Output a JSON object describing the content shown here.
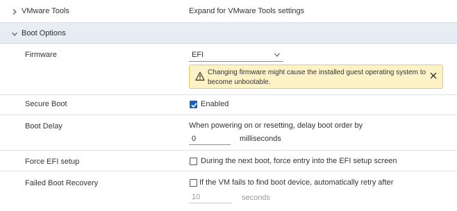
{
  "vmware_tools": {
    "label": "VMware Tools",
    "description": "Expand for VMware Tools settings",
    "icon": "chevron-right-icon"
  },
  "boot_options": {
    "label": "Boot Options",
    "icon": "chevron-down-icon"
  },
  "firmware": {
    "label": "Firmware",
    "selected": "EFI",
    "alert": {
      "message": "Changing firmware might cause the installed guest operating system to become unbootable.",
      "icon": "warning-icon",
      "close_icon": "close-icon"
    }
  },
  "secure_boot": {
    "label": "Secure Boot",
    "checkbox_label": "Enabled",
    "checked": true
  },
  "boot_delay": {
    "label": "Boot Delay",
    "description": "When powering on or resetting, delay boot order by",
    "value": "0",
    "unit": "milliseconds"
  },
  "force_efi": {
    "label": "Force EFI setup",
    "checkbox_label": "During the next boot, force entry into the EFI setup screen",
    "checked": false
  },
  "failed_recovery": {
    "label": "Failed Boot Recovery",
    "checkbox_label": "If the VM fails to find boot device, automatically retry after",
    "checked": false,
    "value": "10",
    "unit": "seconds"
  },
  "colors": {
    "section_header_bg": "#e6edf3",
    "alert_bg": "#fef3c7",
    "alert_border": "#f2c94c",
    "checkbox_checked": "#1565c0"
  }
}
